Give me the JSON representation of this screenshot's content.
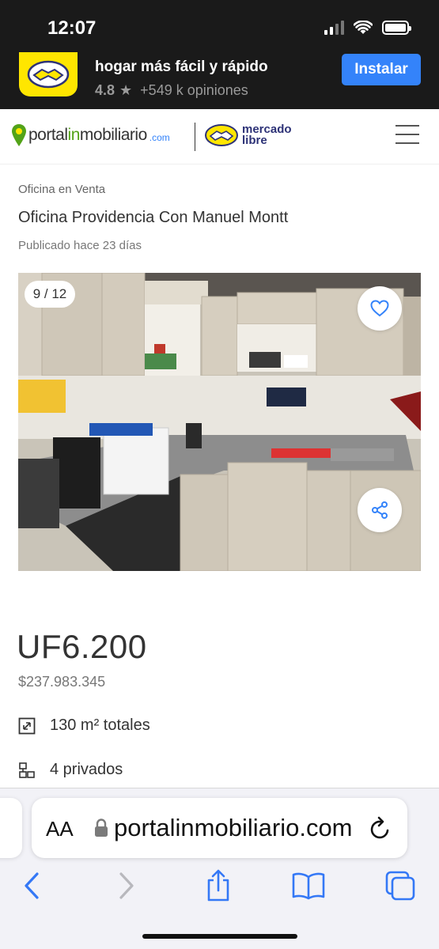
{
  "status_bar": {
    "time": "12:07"
  },
  "app_banner": {
    "title": "hogar más fácil y rápido",
    "rating": "4.8",
    "reviews": "+549 k opiniones",
    "install_label": "Instalar",
    "icon": "handshake-icon"
  },
  "header": {
    "logo_portal_a": "portal",
    "logo_portal_b": "in",
    "logo_portal_c": "mobiliario",
    "logo_com": ".com",
    "logo_ml_1": "mercado",
    "logo_ml_2": "libre"
  },
  "listing": {
    "category": "Oficina en Venta",
    "title": "Oficina Providencia Con Manuel Montt",
    "published": "Publicado hace 23 días",
    "photo_counter": "9 / 12",
    "price": "UF6.200",
    "price_clp": "$237.983.345",
    "features": [
      {
        "icon": "area-icon",
        "label": "130 m² totales"
      },
      {
        "icon": "office-icon",
        "label": "4 privados"
      }
    ]
  },
  "browser": {
    "aa_label": "AA",
    "url": "portalinmobiliario.com"
  },
  "colors": {
    "accent_blue": "#3483fa",
    "brand_yellow": "#ffe600",
    "brand_green": "#53a318",
    "ml_navy": "#2d3277"
  }
}
